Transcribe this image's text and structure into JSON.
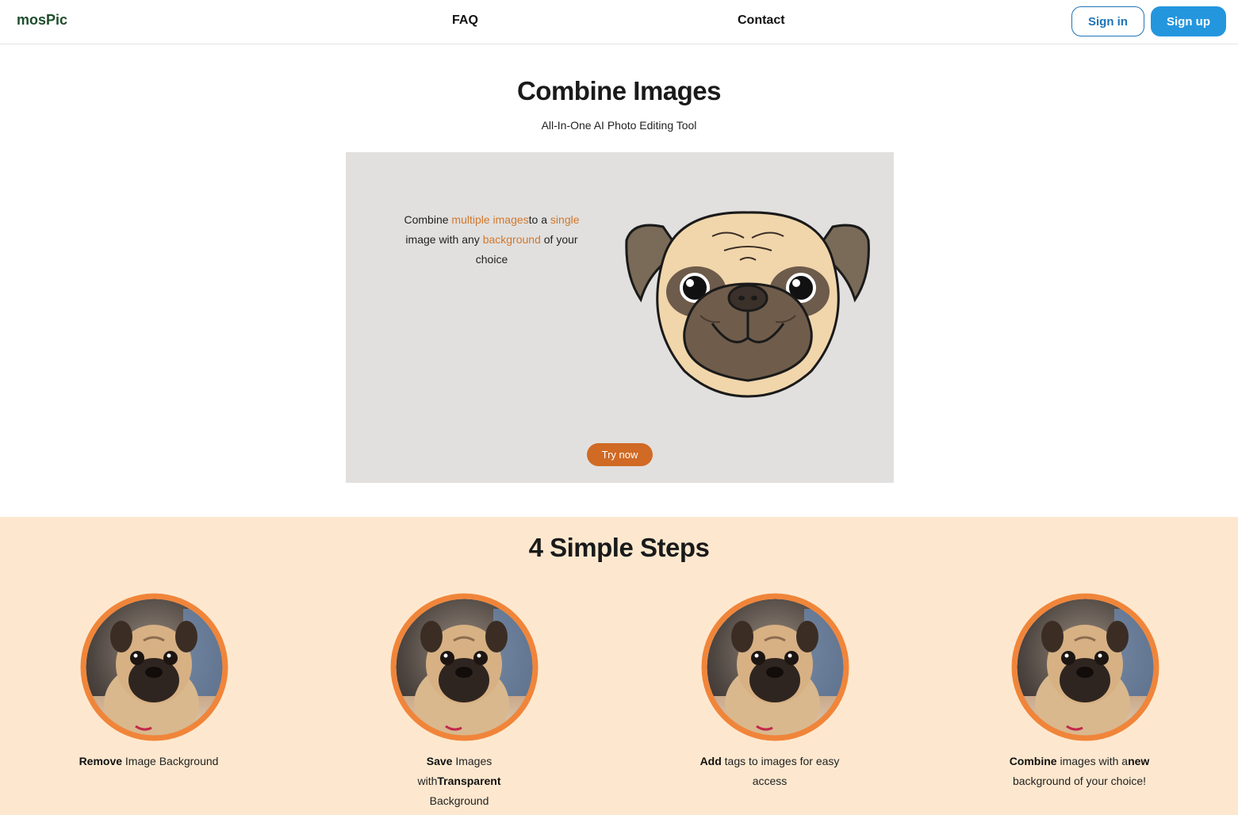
{
  "nav": {
    "logo": "mosPic",
    "links": [
      "FAQ",
      "Contact"
    ],
    "signin_label": "Sign in",
    "signup_label": "Sign up"
  },
  "hero": {
    "title": "Combine Images",
    "subtitle": "All-In-One AI Photo Editing Tool",
    "text": {
      "part1": "Combine ",
      "accent1": "multiple images",
      "part2": "to a ",
      "accent2": "single",
      "part3": " image with any ",
      "accent3": "background",
      "part4": " of your choice"
    },
    "cta_label": "Try now",
    "illustration": "pug-face-illustration"
  },
  "steps": {
    "title": "4 Simple Steps",
    "items": [
      {
        "bold1": "Remove",
        "text1": " Image Background",
        "bold2": "",
        "text2": "",
        "image": "pug-photo"
      },
      {
        "bold1": "Save",
        "text1": " Images with",
        "bold2": "Transparent",
        "text2": " Background",
        "image": "pug-photo"
      },
      {
        "bold1": "Add",
        "text1": " tags to images for easy access",
        "bold2": "",
        "text2": "",
        "image": "pug-photo"
      },
      {
        "bold1": "Combine",
        "text1": " images with a",
        "bold2": "new",
        "text2": " background of your choice!",
        "image": "pug-photo"
      }
    ]
  },
  "colors": {
    "logo": "#1f4d2c",
    "primary": "#2496de",
    "accent": "#d2772a",
    "cta": "#d06a24",
    "ring": "#f0853a",
    "steps_bg": "#fde8cf",
    "hero_card_bg": "#e1e0df"
  }
}
